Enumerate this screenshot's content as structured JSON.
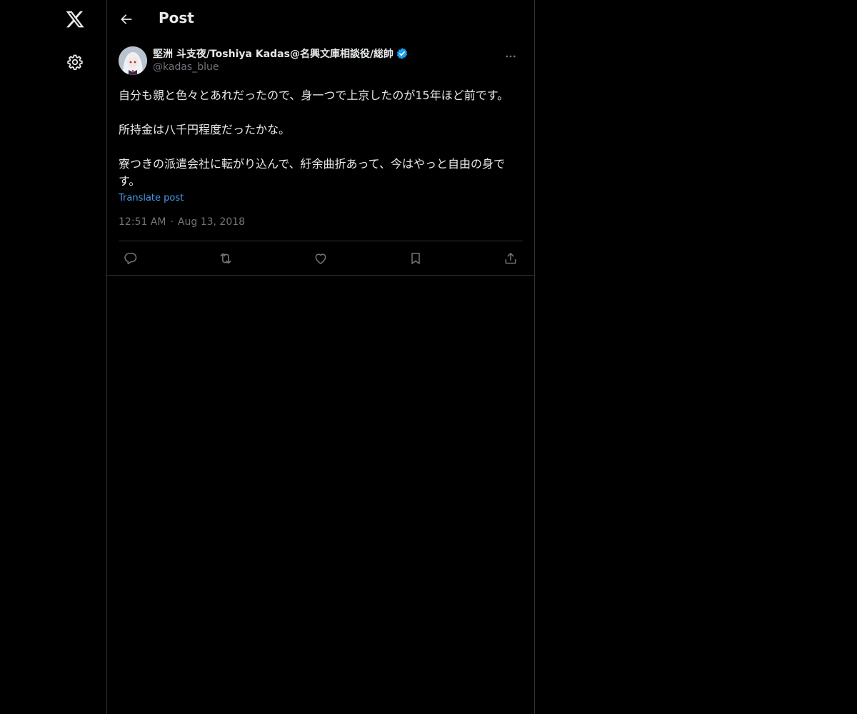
{
  "nav": {
    "logo_icon": "x-logo-icon",
    "settings_icon": "gear-icon"
  },
  "header": {
    "back_icon": "arrow-left-icon",
    "title": "Post"
  },
  "post": {
    "author": {
      "display_name": "堅洲 斗支夜/Toshiya Kadas@名興文庫相談役/総帥",
      "handle": "@kadas_blue",
      "verified": true
    },
    "text": "自分も親と色々とあれだったので、身一つで上京したのが15年ほど前です。\n\n所持金は八千円程度だったかな。\n\n寮つきの派遣会社に転がり込んで、紆余曲折あって、今はやっと自由の身です。",
    "translate_label": "Translate post",
    "time": "12:51 AM",
    "separator": "·",
    "date": "Aug 13, 2018",
    "actions": [
      "reply-icon",
      "repost-icon",
      "like-icon",
      "bookmark-icon",
      "share-icon"
    ]
  },
  "colors": {
    "background": "#000000",
    "text_primary": "#e7e9ea",
    "text_secondary": "#71767b",
    "link": "#4a99e9",
    "verified": "#1d9bf0",
    "border": "#2f3336"
  }
}
